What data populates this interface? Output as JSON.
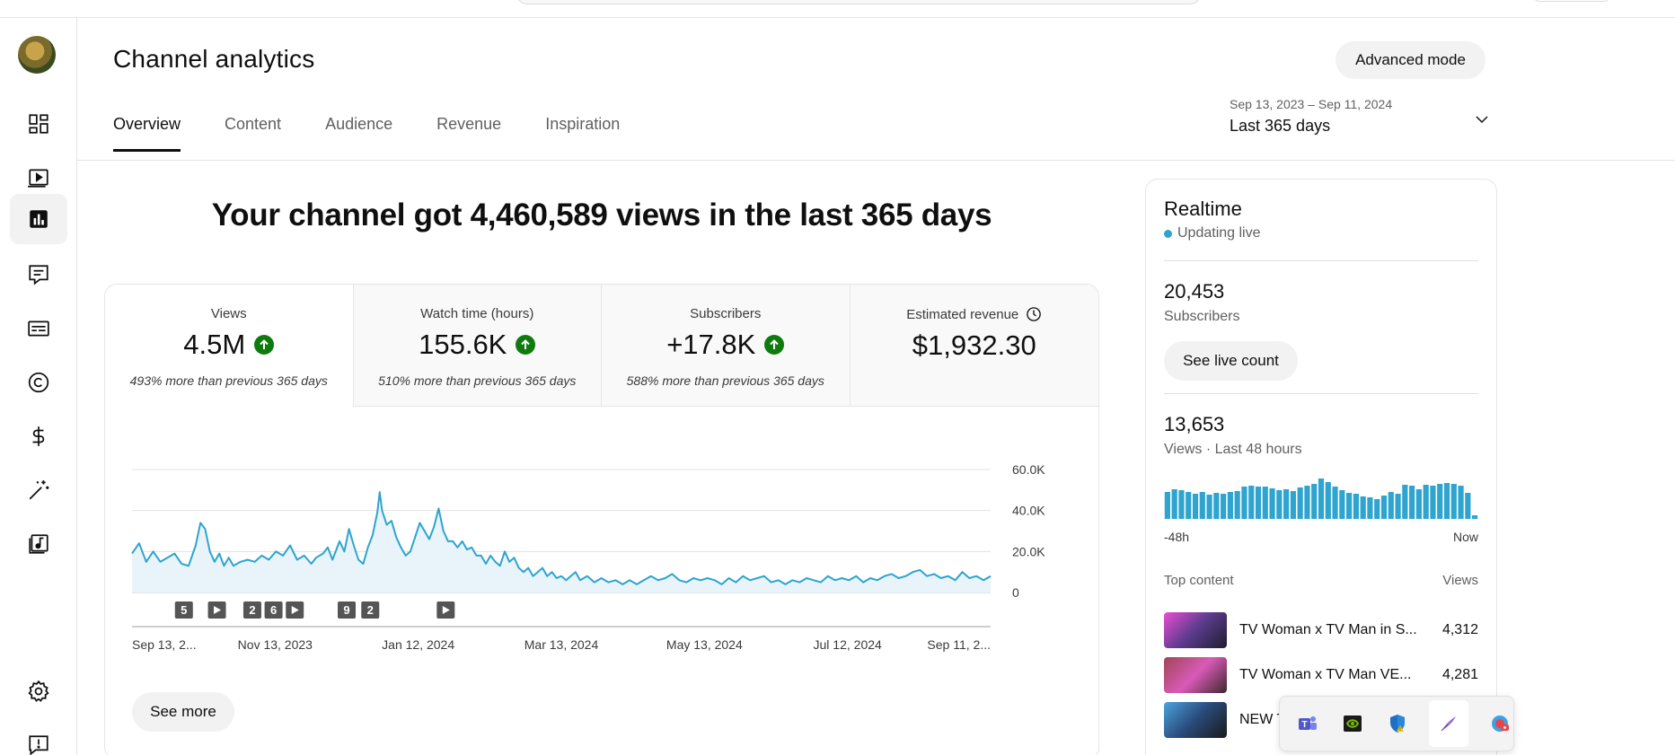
{
  "header": {
    "title": "Channel analytics",
    "advanced_mode": "Advanced mode",
    "tabs": [
      "Overview",
      "Content",
      "Audience",
      "Revenue",
      "Inspiration"
    ],
    "active_tab": "Overview",
    "date_range": {
      "dates": "Sep 13, 2023 – Sep 11, 2024",
      "label": "Last 365 days"
    }
  },
  "sidebar": {
    "icons": [
      "avatar",
      "dashboard-icon",
      "content-icon",
      "analytics-icon",
      "comments-icon",
      "subtitles-icon",
      "copyright-icon",
      "earn-icon",
      "customization-icon",
      "audio-library-icon",
      "settings-icon",
      "feedback-icon"
    ],
    "active": "analytics-icon"
  },
  "headline": "Your channel got 4,460,589 views in the last 365 days",
  "metrics": [
    {
      "label": "Views",
      "value": "4.5M",
      "trend": "up",
      "compare": "493% more than previous 365 days"
    },
    {
      "label": "Watch time (hours)",
      "value": "155.6K",
      "trend": "up",
      "compare": "510% more than previous 365 days"
    },
    {
      "label": "Subscribers",
      "value": "+17.8K",
      "trend": "up",
      "compare": "588% more than previous 365 days"
    },
    {
      "label": "Estimated revenue",
      "value": "$1,932.30",
      "trend": "none",
      "compare": ""
    }
  ],
  "see_more": "See more",
  "chart_data": {
    "type": "area",
    "color": "#2ea4cf",
    "fill": "#e8f4fa",
    "y_ticks": [
      "60.0K",
      "40.0K",
      "20.0K",
      "0"
    ],
    "ylim": [
      0,
      60000
    ],
    "x_ticks": [
      "Sep 13, 2...",
      "Nov 13, 2023",
      "Jan 12, 2024",
      "Mar 13, 2024",
      "May 13, 2024",
      "Jul 12, 2024",
      "Sep 11, 2..."
    ],
    "grid": true,
    "markers": [
      {
        "kind": "number",
        "text": "5",
        "day": 22
      },
      {
        "kind": "play",
        "text": "",
        "day": 36
      },
      {
        "kind": "number",
        "text": "2",
        "day": 51
      },
      {
        "kind": "number",
        "text": "6",
        "day": 60
      },
      {
        "kind": "play",
        "text": "",
        "day": 69
      },
      {
        "kind": "number",
        "text": "9",
        "day": 91
      },
      {
        "kind": "number",
        "text": "2",
        "day": 101
      },
      {
        "kind": "play",
        "text": "",
        "day": 133
      }
    ],
    "points": [
      [
        0,
        19000
      ],
      [
        3,
        24000
      ],
      [
        6,
        15000
      ],
      [
        9,
        20000
      ],
      [
        12,
        15000
      ],
      [
        15,
        17000
      ],
      [
        18,
        19000
      ],
      [
        21,
        14000
      ],
      [
        24,
        13000
      ],
      [
        27,
        23000
      ],
      [
        29,
        34000
      ],
      [
        31,
        31000
      ],
      [
        33,
        20000
      ],
      [
        35,
        15000
      ],
      [
        37,
        19000
      ],
      [
        39,
        13000
      ],
      [
        41,
        17000
      ],
      [
        43,
        13000
      ],
      [
        46,
        15000
      ],
      [
        49,
        16000
      ],
      [
        52,
        15000
      ],
      [
        55,
        18000
      ],
      [
        58,
        16000
      ],
      [
        61,
        20000
      ],
      [
        64,
        18000
      ],
      [
        67,
        23000
      ],
      [
        70,
        16000
      ],
      [
        73,
        18000
      ],
      [
        76,
        14000
      ],
      [
        78,
        17000
      ],
      [
        81,
        19000
      ],
      [
        83,
        22000
      ],
      [
        85,
        16000
      ],
      [
        88,
        25000
      ],
      [
        90,
        20000
      ],
      [
        92,
        31000
      ],
      [
        94,
        23000
      ],
      [
        96,
        16000
      ],
      [
        98,
        14000
      ],
      [
        100,
        22000
      ],
      [
        102,
        28000
      ],
      [
        104,
        39000
      ],
      [
        105,
        49000
      ],
      [
        106,
        40000
      ],
      [
        108,
        33000
      ],
      [
        110,
        35000
      ],
      [
        112,
        27000
      ],
      [
        114,
        22000
      ],
      [
        116,
        18000
      ],
      [
        118,
        20000
      ],
      [
        120,
        27000
      ],
      [
        122,
        34000
      ],
      [
        124,
        30000
      ],
      [
        126,
        26000
      ],
      [
        128,
        32000
      ],
      [
        130,
        41000
      ],
      [
        132,
        30000
      ],
      [
        134,
        25000
      ],
      [
        136,
        25000
      ],
      [
        138,
        22000
      ],
      [
        140,
        25000
      ],
      [
        142,
        21000
      ],
      [
        144,
        22000
      ],
      [
        146,
        18000
      ],
      [
        148,
        18000
      ],
      [
        150,
        14000
      ],
      [
        152,
        18000
      ],
      [
        154,
        15000
      ],
      [
        156,
        13000
      ],
      [
        158,
        20000
      ],
      [
        160,
        15000
      ],
      [
        162,
        17000
      ],
      [
        164,
        12000
      ],
      [
        166,
        10000
      ],
      [
        168,
        12000
      ],
      [
        170,
        8000
      ],
      [
        172,
        10000
      ],
      [
        174,
        12000
      ],
      [
        176,
        8000
      ],
      [
        178,
        10000
      ],
      [
        180,
        7000
      ],
      [
        182,
        8000
      ],
      [
        184,
        6000
      ],
      [
        186,
        8000
      ],
      [
        188,
        10000
      ],
      [
        190,
        6000
      ],
      [
        193,
        8000
      ],
      [
        196,
        5000
      ],
      [
        199,
        7000
      ],
      [
        202,
        5000
      ],
      [
        205,
        6000
      ],
      [
        208,
        4000
      ],
      [
        211,
        6000
      ],
      [
        214,
        4000
      ],
      [
        217,
        6000
      ],
      [
        220,
        8000
      ],
      [
        223,
        6000
      ],
      [
        226,
        7000
      ],
      [
        229,
        9000
      ],
      [
        232,
        6000
      ],
      [
        235,
        5000
      ],
      [
        238,
        7000
      ],
      [
        241,
        6000
      ],
      [
        244,
        7000
      ],
      [
        247,
        6000
      ],
      [
        250,
        4000
      ],
      [
        253,
        7000
      ],
      [
        256,
        5000
      ],
      [
        259,
        8000
      ],
      [
        262,
        6000
      ],
      [
        265,
        7000
      ],
      [
        268,
        8000
      ],
      [
        271,
        5000
      ],
      [
        274,
        6000
      ],
      [
        277,
        4000
      ],
      [
        280,
        6000
      ],
      [
        283,
        5000
      ],
      [
        286,
        7000
      ],
      [
        289,
        6000
      ],
      [
        292,
        5000
      ],
      [
        295,
        8000
      ],
      [
        298,
        6000
      ],
      [
        301,
        7000
      ],
      [
        304,
        6000
      ],
      [
        307,
        8000
      ],
      [
        310,
        5000
      ],
      [
        313,
        7000
      ],
      [
        316,
        6000
      ],
      [
        319,
        8000
      ],
      [
        322,
        9000
      ],
      [
        325,
        7000
      ],
      [
        328,
        8000
      ],
      [
        331,
        10000
      ],
      [
        334,
        11000
      ],
      [
        337,
        8000
      ],
      [
        340,
        9000
      ],
      [
        343,
        7000
      ],
      [
        346,
        8000
      ],
      [
        349,
        6000
      ],
      [
        352,
        10000
      ],
      [
        355,
        7000
      ],
      [
        358,
        8000
      ],
      [
        361,
        6000
      ],
      [
        364,
        8000
      ]
    ]
  },
  "realtime": {
    "title": "Realtime",
    "live": "Updating live",
    "subscribers_value": "20,453",
    "subscribers_label": "Subscribers",
    "see_live_count": "See live count",
    "views_value": "13,653",
    "views_label": "Views · Last 48 hours",
    "bar_color": "#2ea4cf",
    "bars": [
      30,
      33,
      32,
      30,
      28,
      30,
      27,
      29,
      28,
      30,
      31,
      36,
      37,
      36,
      36,
      34,
      32,
      33,
      31,
      35,
      37,
      39,
      45,
      41,
      36,
      32,
      29,
      28,
      25,
      24,
      22,
      26,
      30,
      28,
      38,
      37,
      33,
      38,
      37,
      39,
      40,
      39,
      37,
      29,
      4
    ],
    "axis_start": "-48h",
    "axis_end": "Now",
    "top_content_label": "Top content",
    "top_content_views_label": "Views",
    "top_content": [
      {
        "title": "TV Woman x TV Man in S...",
        "views": "4,312",
        "thumb_color": "#c46ad8"
      },
      {
        "title": "TV Woman x TV Man VE...",
        "views": "4,281",
        "thumb_color": "#8a3b4a"
      },
      {
        "title": "NEW T",
        "views": "",
        "thumb_color": "#3d6fb0"
      }
    ]
  },
  "tray": {
    "icons": [
      "teams-icon",
      "nvidia-icon",
      "defender-icon",
      "pen-icon",
      "screen-recorder-icon"
    ],
    "selected": "pen-icon"
  }
}
